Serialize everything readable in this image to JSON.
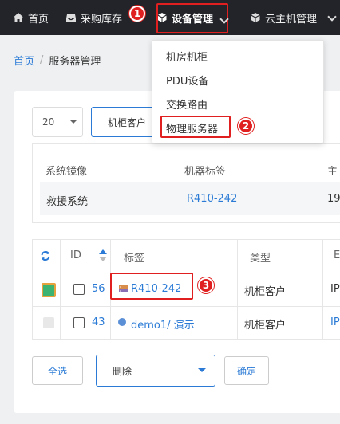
{
  "nav": {
    "home": "首页",
    "inventory": "采购库存",
    "device_mgmt": "设备管理",
    "cloud_host": "云主机管理",
    "markers": [
      "1",
      "2",
      "3"
    ]
  },
  "dropdown": {
    "items": [
      "机房机柜",
      "PDU设备",
      "交换路由",
      "物理服务器"
    ]
  },
  "breadcrumb": {
    "home": "首页",
    "sep": "/",
    "current": "服务器管理"
  },
  "toolbar": {
    "page_size": "20",
    "cabinet_customer": "机柜客户"
  },
  "detail": {
    "labels": [
      "系统镜像",
      "机器标签",
      "主"
    ],
    "values": [
      "救援系统",
      "R410-242",
      "19"
    ]
  },
  "table": {
    "headers": [
      "ID",
      "标签",
      "类型",
      "E"
    ],
    "rows": [
      {
        "id": "56",
        "label": "R410-242",
        "type": "机柜客户",
        "extra": "IP"
      },
      {
        "id": "43",
        "label": "demo1/ 演示",
        "type": "机柜客户",
        "extra": "IP"
      }
    ]
  },
  "footer": {
    "select_all": "全选",
    "action": "删除",
    "confirm": "确定"
  },
  "colors": {
    "nav_bg": "#222429",
    "link": "#2b7bd6",
    "highlight": "#e02020",
    "status_green": "#3cb371"
  }
}
